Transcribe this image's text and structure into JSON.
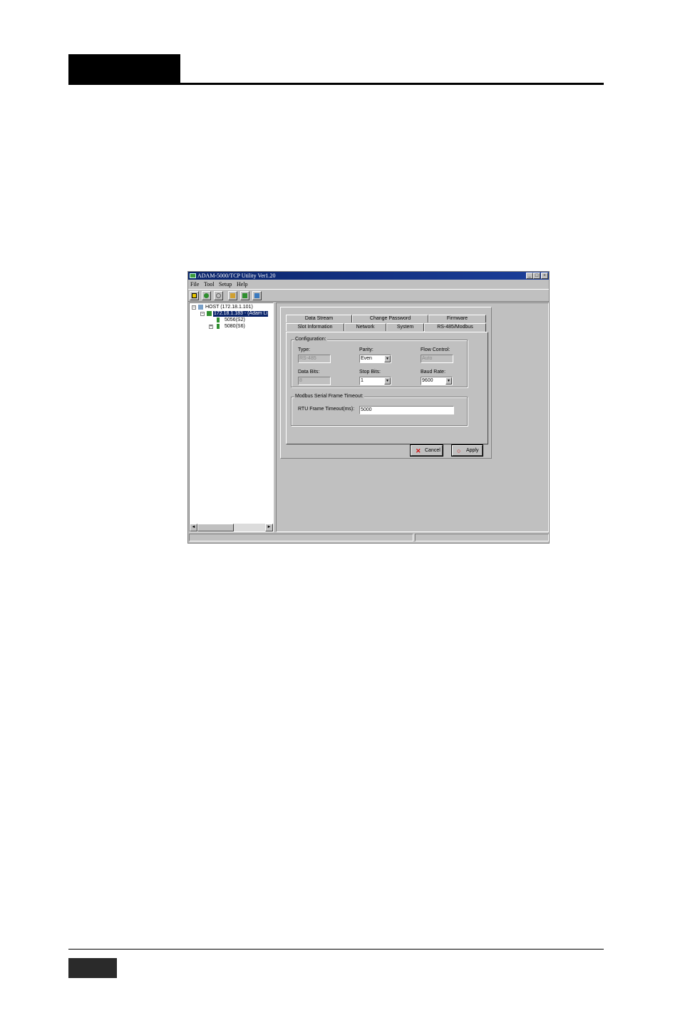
{
  "window": {
    "title": "ADAM-5000/TCP Utility Ver1.20",
    "controls": {
      "minimize": "_",
      "maximize": "□",
      "close": "×"
    }
  },
  "menu": [
    "File",
    "Tool",
    "Setup",
    "Help"
  ],
  "toolbar": {
    "icons": [
      "exit-icon",
      "search-network-icon",
      "find-icon",
      "print-icon",
      "connect-icon",
      "monitor-icon"
    ],
    "colors": {
      "exit": "#e8c800",
      "search": "#2f8f2f",
      "find": "#8a8a8a",
      "print": "#d0a030",
      "connect": "#2f8f2f",
      "monitor": "#3a7abf"
    }
  },
  "tree": {
    "root": {
      "label": "HOST (172.18.1.101)",
      "toggle": "−"
    },
    "device": {
      "label": "172.18.1.183 - (Adam Li",
      "toggle": "−"
    },
    "modules": [
      {
        "label": "5056(S2)",
        "toggle": ""
      },
      {
        "label": "5080(S6)",
        "toggle": "+"
      }
    ],
    "scroll_left": "◄",
    "scroll_right": "►"
  },
  "tabs": {
    "row_back": [
      "Data Stream",
      "Change Password",
      "Firmware"
    ],
    "row_front": [
      "Slot Information",
      "Network",
      "System",
      "RS-485/Modbus"
    ],
    "active": "RS-485/Modbus"
  },
  "configuration": {
    "group_label": "Configuration:",
    "type": {
      "label": "Type:",
      "value": "RS-485"
    },
    "parity": {
      "label": "Parity:",
      "value": "Even"
    },
    "flow_control": {
      "label": "Flow Control:",
      "value": "Auto"
    },
    "data_bits": {
      "label": "Data Bits:",
      "value": "8"
    },
    "stop_bits": {
      "label": "Stop Bits:",
      "value": "1"
    },
    "baud_rate": {
      "label": "Baud Rate:",
      "value": "9600"
    },
    "dropdown_arrow": "▼"
  },
  "timeout": {
    "group_label": "Modbus Serial Frame Timeout:",
    "label": "RTU Frame Timeout(ms):",
    "value": "5000"
  },
  "buttons": {
    "cancel": {
      "label": "Cancel",
      "icon": "✕",
      "icon_color": "#cc1010"
    },
    "apply": {
      "label": "Apply",
      "icon": "○",
      "icon_color": "#cc1010"
    }
  }
}
